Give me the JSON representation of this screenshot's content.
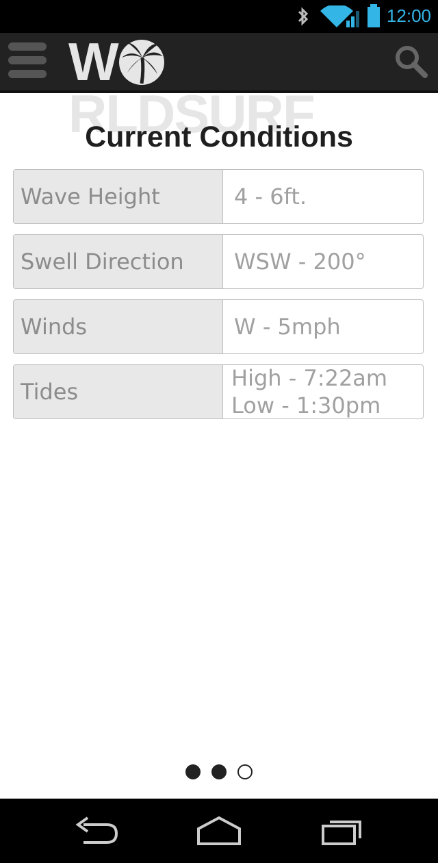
{
  "status_bar": {
    "time": "12:00",
    "icons": [
      "bluetooth-icon",
      "wifi-icon",
      "signal-icon",
      "battery-icon"
    ],
    "accent_color": "#33b5e5"
  },
  "app_bar": {
    "logo_text_left": "W",
    "logo_text_right": "RLDSURF",
    "menu_icon": "hamburger-icon",
    "search_icon": "search-icon"
  },
  "page": {
    "title": "Current Conditions"
  },
  "conditions": [
    {
      "label": "Wave Height",
      "value": "4 - 6ft."
    },
    {
      "label": "Swell Direction",
      "value": "WSW - 200°"
    },
    {
      "label": "Winds",
      "value": "W - 5mph"
    },
    {
      "label": "Tides",
      "value_line1": "High - 7:22am",
      "value_line2": "Low - 1:30pm"
    }
  ],
  "pager": {
    "pages": 3,
    "active_dots": [
      1,
      2
    ],
    "empty_dot": 3
  },
  "nav_bar": {
    "icons": [
      "back-icon",
      "home-icon",
      "recent-apps-icon"
    ]
  }
}
